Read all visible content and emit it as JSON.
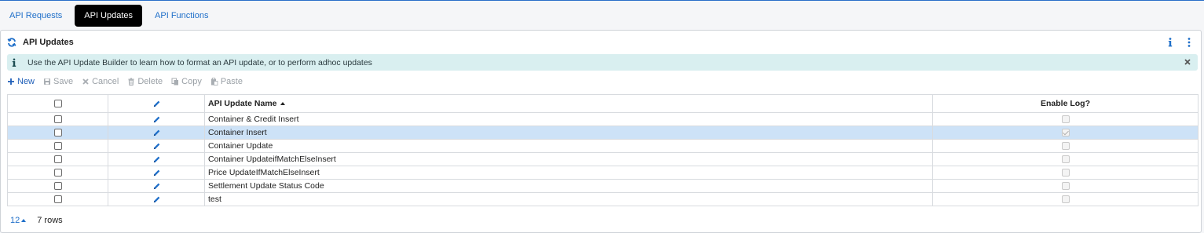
{
  "tabs": [
    {
      "label": "API Requests",
      "active": false
    },
    {
      "label": "API Updates",
      "active": true
    },
    {
      "label": "API Functions",
      "active": false
    }
  ],
  "panel": {
    "title": "API Updates",
    "icons": {
      "refresh": "refresh-icon",
      "info": "info-icon",
      "more": "more-vertical-icon"
    }
  },
  "alert": {
    "text": "Use the API Update Builder to learn how to format an API update, or to perform adhoc updates",
    "icon": "info-icon",
    "close_icon": "close-icon"
  },
  "toolbar": {
    "new_label": "New",
    "save_label": "Save",
    "cancel_label": "Cancel",
    "delete_label": "Delete",
    "copy_label": "Copy",
    "paste_label": "Paste"
  },
  "grid": {
    "columns": {
      "name": "API Update Name",
      "enable_log": "Enable Log?"
    },
    "sort": {
      "column": "name",
      "direction": "ascending"
    },
    "rows": [
      {
        "name": "Container & Credit Insert",
        "enable_log": false,
        "selected": false
      },
      {
        "name": "Container Insert",
        "enable_log": true,
        "selected": true
      },
      {
        "name": "Container Update",
        "enable_log": false,
        "selected": false
      },
      {
        "name": "Container UpdateifMatchElseInsert",
        "enable_log": false,
        "selected": false
      },
      {
        "name": "Price UpdateIfMatchElseInsert",
        "enable_log": false,
        "selected": false
      },
      {
        "name": "Settlement Update Status Code",
        "enable_log": false,
        "selected": false
      },
      {
        "name": "test",
        "enable_log": false,
        "selected": false
      }
    ]
  },
  "footer": {
    "page_size": "12",
    "row_count": "7 rows"
  },
  "colors": {
    "accent": "#1f6fc9",
    "active_tab_bg": "#000000",
    "alert_bg": "#d9eff0",
    "selected_row_bg": "#cde2f7"
  }
}
